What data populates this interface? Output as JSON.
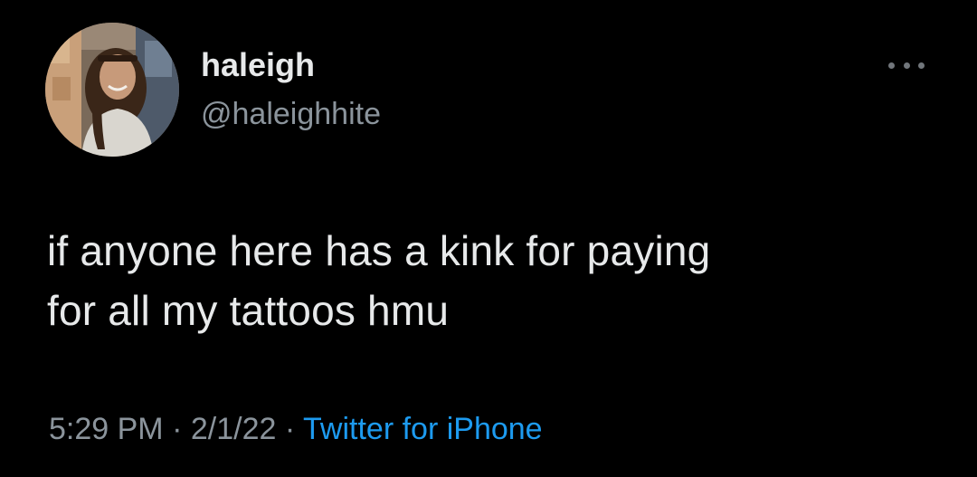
{
  "colors": {
    "background": "#000000",
    "text_primary": "#e7e9ea",
    "text_secondary": "#8b949c",
    "link": "#1d9bf0"
  },
  "user": {
    "display_name": "haleigh",
    "handle": "@haleighhite",
    "avatar_icon": "profile-photo"
  },
  "tweet": {
    "text_lines": [
      "if anyone here has a kink for paying",
      "for all my tattoos hmu"
    ]
  },
  "meta": {
    "time": "5:29 PM",
    "separator": "·",
    "date": "2/1/22",
    "source": "Twitter for iPhone"
  },
  "more_icon": "more-dots-icon"
}
